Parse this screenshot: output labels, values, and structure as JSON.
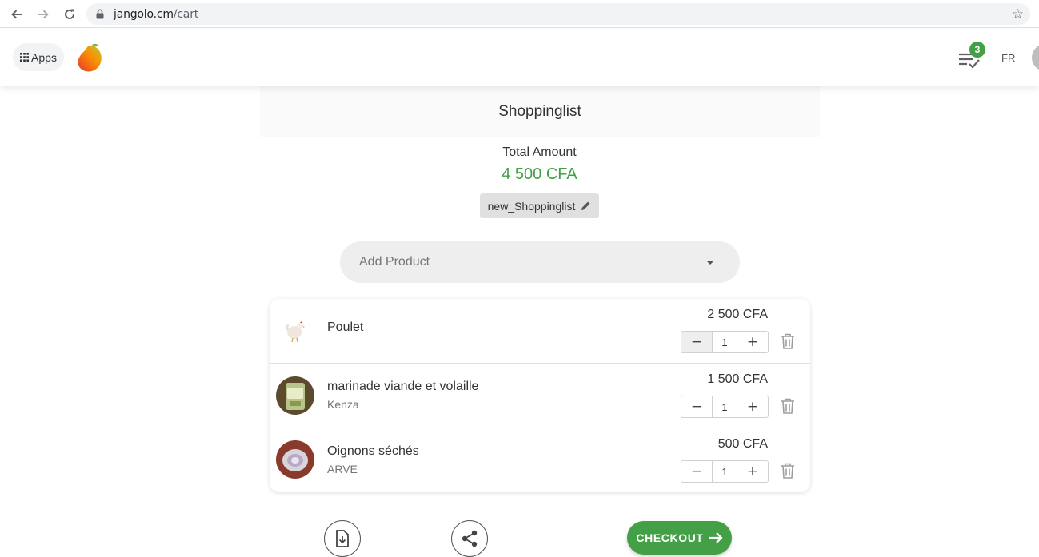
{
  "browser": {
    "url_domain": "jangolo.cm",
    "url_path": "/cart"
  },
  "header": {
    "apps_label": "Apps",
    "list_badge_count": "3",
    "language": "FR"
  },
  "page": {
    "title": "Shoppinglist",
    "total_label": "Total Amount",
    "total_value": "4 500 CFA",
    "list_name": "new_Shoppinglist",
    "add_product_placeholder": "Add Product"
  },
  "cart": {
    "items": [
      {
        "name": "Poulet",
        "brand": "",
        "price": "2 500 CFA",
        "quantity": "1"
      },
      {
        "name": "marinade viande et volaille",
        "brand": "Kenza",
        "price": "1 500 CFA",
        "quantity": "1"
      },
      {
        "name": "Oignons séchés",
        "brand": "ARVE",
        "price": "500 CFA",
        "quantity": "1"
      }
    ],
    "minus_symbol": "−",
    "plus_symbol": "+"
  },
  "actions": {
    "checkout_label": "CHECKOUT",
    "checkout_arrow": "→"
  },
  "colors": {
    "accent_green": "#43a047",
    "chip_gray": "#e0e0e0"
  },
  "icons": [
    "back-arrow-icon",
    "forward-arrow-icon",
    "reload-icon",
    "lock-icon",
    "star-icon",
    "apps-grid-icon",
    "mango-logo",
    "checklist-icon",
    "pencil-icon",
    "caret-down-icon",
    "trash-icon",
    "download-file-icon",
    "share-icon",
    "arrow-right-icon"
  ]
}
